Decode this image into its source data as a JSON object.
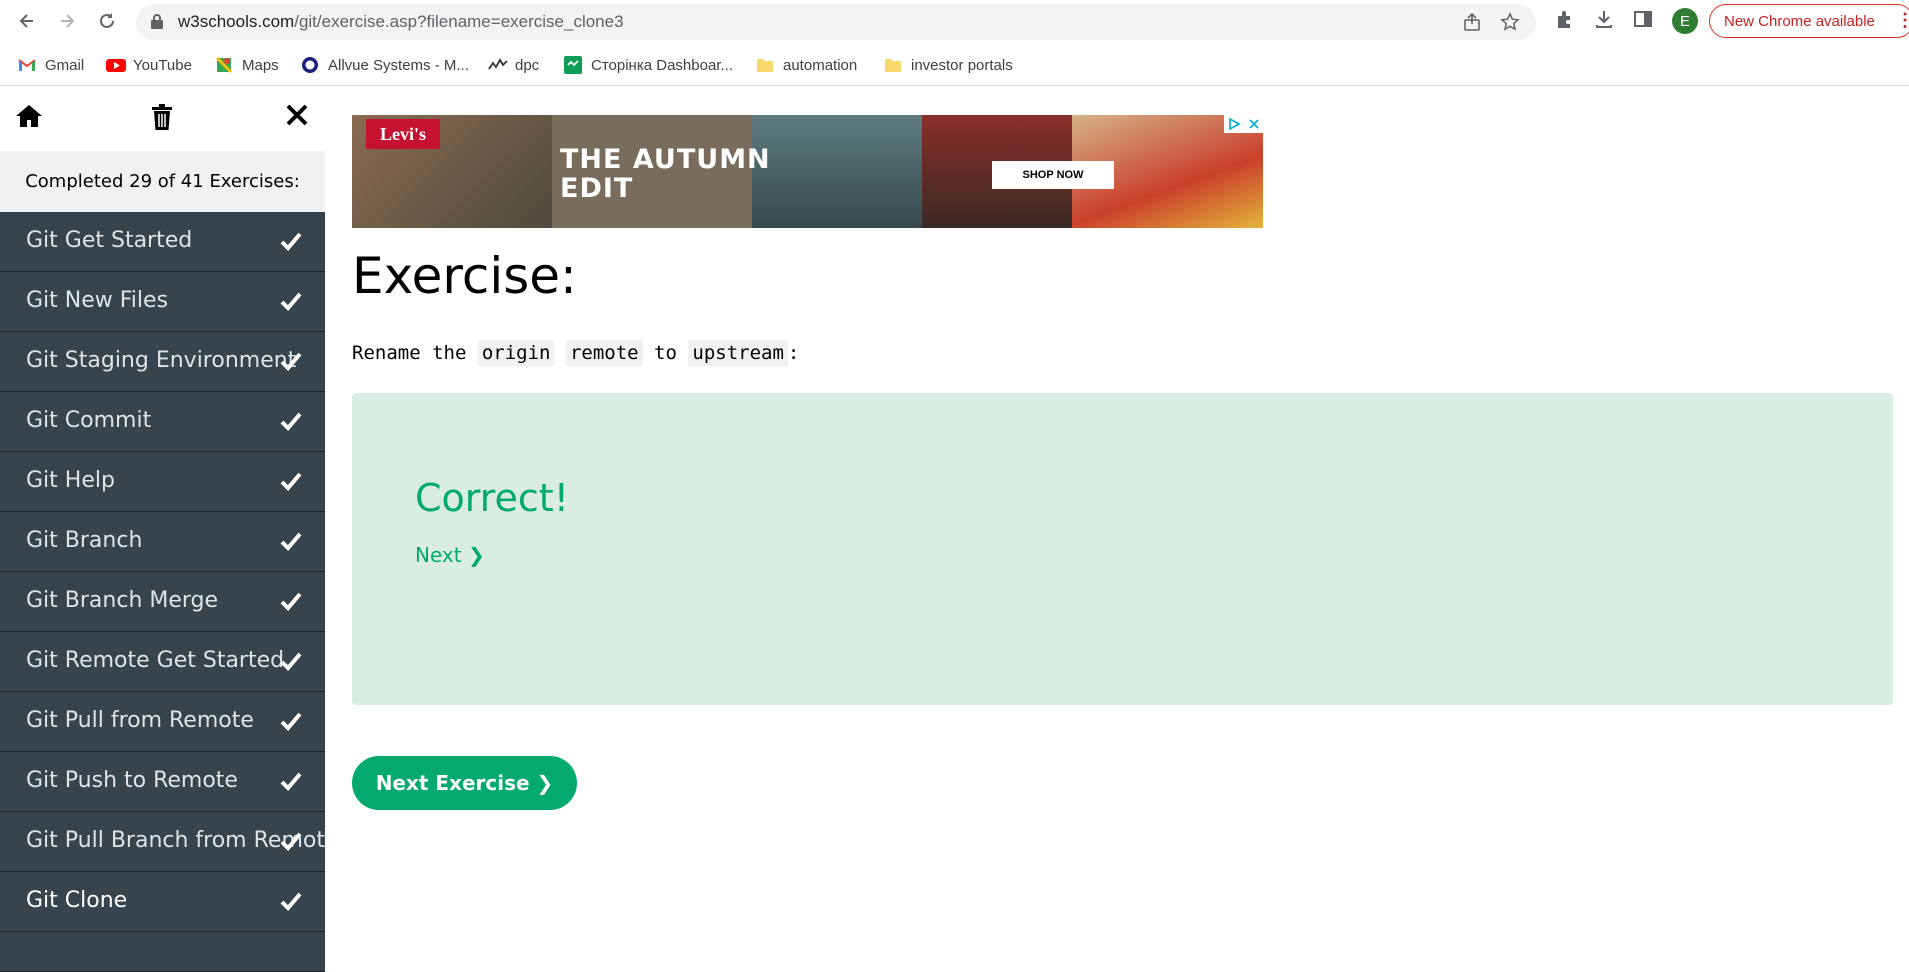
{
  "browser": {
    "url_domain": "w3schools.com",
    "url_path": "/git/exercise.asp?filename=exercise_clone3",
    "avatar_letter": "E",
    "update_label": "New Chrome available"
  },
  "bookmarks": [
    {
      "label": "Gmail",
      "icon": "gmail-icon"
    },
    {
      "label": "YouTube",
      "icon": "youtube-icon"
    },
    {
      "label": "Maps",
      "icon": "maps-icon"
    },
    {
      "label": "Allvue Systems - M...",
      "icon": "allvue-icon"
    },
    {
      "label": "dpc",
      "icon": "dpc-icon"
    },
    {
      "label": "Сторінка Dashboar...",
      "icon": "dashboard-icon"
    },
    {
      "label": "automation",
      "icon": "folder-icon"
    },
    {
      "label": "investor portals",
      "icon": "folder-icon"
    }
  ],
  "sidebar": {
    "progress": "Completed 29 of 41 Exercises:",
    "items": [
      {
        "label": "Git Get Started",
        "done": true
      },
      {
        "label": "Git New Files",
        "done": true
      },
      {
        "label": "Git Staging Environment",
        "done": true
      },
      {
        "label": "Git Commit",
        "done": true
      },
      {
        "label": "Git Help",
        "done": true
      },
      {
        "label": "Git Branch",
        "done": true
      },
      {
        "label": "Git Branch Merge",
        "done": true
      },
      {
        "label": "Git Remote Get Started",
        "done": true
      },
      {
        "label": "Git Pull from Remote",
        "done": true
      },
      {
        "label": "Git Push to Remote",
        "done": true
      },
      {
        "label": "Git Pull Branch from Remote",
        "done": true
      },
      {
        "label": "Git Clone",
        "done": true
      }
    ]
  },
  "ad": {
    "brand": "Levi's",
    "headline_line1": "THE AUTUMN",
    "headline_line2": "EDIT",
    "cta": "SHOP NOW"
  },
  "exercise": {
    "title": "Exercise:",
    "instr_prefix": "Rename the",
    "code1": "origin",
    "code2": "remote",
    "instr_mid": "to",
    "code3": "upstream",
    "instr_suffix": ":",
    "result": "Correct!",
    "next_link": "Next ❯",
    "next_button": "Next Exercise ❯"
  },
  "colors": {
    "accent": "#04aa6d",
    "sidebar_bg": "#38444d",
    "result_bg": "#d9ede2"
  }
}
